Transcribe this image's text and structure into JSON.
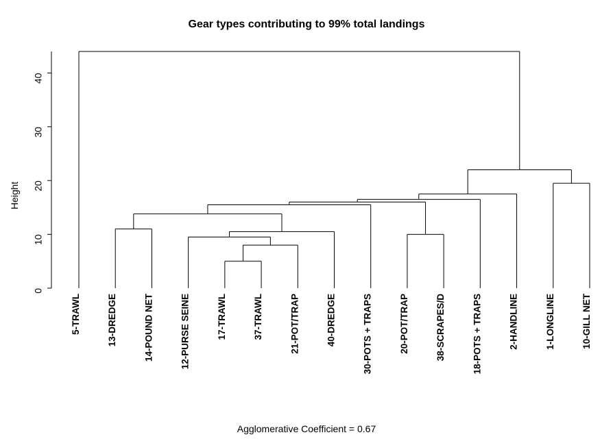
{
  "chart_data": {
    "type": "dendrogram",
    "title": "Gear types contributing to 99% total landings",
    "ylabel": "Height",
    "ylim": [
      0,
      44
    ],
    "yticks": [
      0,
      10,
      20,
      30,
      40
    ],
    "footer": "Agglomerative Coefficient =  0.67",
    "leaves": [
      {
        "id": "L1",
        "label": "5-TRAWL"
      },
      {
        "id": "L2",
        "label": "13-DREDGE"
      },
      {
        "id": "L3",
        "label": "14-POUND NET"
      },
      {
        "id": "L4",
        "label": "12-PURSE SEINE"
      },
      {
        "id": "L5",
        "label": "17-TRAWL"
      },
      {
        "id": "L6",
        "label": "37-TRAWL"
      },
      {
        "id": "L7",
        "label": "21-POT/TRAP"
      },
      {
        "id": "L8",
        "label": "40-DREDGE"
      },
      {
        "id": "L9",
        "label": "30-POTS + TRAPS"
      },
      {
        "id": "L10",
        "label": "20-POT/TRAP"
      },
      {
        "id": "L11",
        "label": "38-SCRAPES/D"
      },
      {
        "id": "L12",
        "label": "18-POTS + TRAPS"
      },
      {
        "id": "L13",
        "label": "2-HANDLINE"
      },
      {
        "id": "L14",
        "label": "1-LONGLINE"
      },
      {
        "id": "L15",
        "label": "10-GILL NET"
      }
    ],
    "merges": [
      {
        "id": "M1",
        "left": "L5",
        "right": "L6",
        "height": 5.0
      },
      {
        "id": "M2",
        "left": "M1",
        "right": "L7",
        "height": 8.0
      },
      {
        "id": "M3",
        "left": "L4",
        "right": "M2",
        "height": 9.5
      },
      {
        "id": "M4",
        "left": "M3",
        "right": "L8",
        "height": 10.5
      },
      {
        "id": "M5",
        "left": "L2",
        "right": "L3",
        "height": 11.0
      },
      {
        "id": "M6",
        "left": "M5",
        "right": "M4",
        "height": 13.8
      },
      {
        "id": "M7",
        "left": "M6",
        "right": "L9",
        "height": 15.5
      },
      {
        "id": "M8",
        "left": "L10",
        "right": "L11",
        "height": 10.0
      },
      {
        "id": "M9",
        "left": "M7",
        "right": "M8",
        "height": 16.0
      },
      {
        "id": "M10",
        "left": "M9",
        "right": "L12",
        "height": 16.5
      },
      {
        "id": "M11",
        "left": "M10",
        "right": "L13",
        "height": 17.5
      },
      {
        "id": "M12",
        "left": "L14",
        "right": "L15",
        "height": 19.5
      },
      {
        "id": "M13",
        "left": "M11",
        "right": "M12",
        "height": 22.0
      },
      {
        "id": "M14",
        "left": "L1",
        "right": "M13",
        "height": 44.0
      }
    ]
  }
}
